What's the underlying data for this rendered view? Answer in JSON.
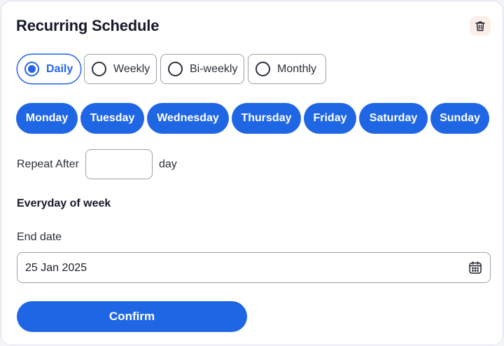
{
  "header": {
    "title": "Recurring Schedule",
    "delete_icon": "trash-icon"
  },
  "frequency": {
    "selected": "Daily",
    "options": [
      "Daily",
      "Weekly",
      "Bi-weekly",
      "Monthly"
    ]
  },
  "days": [
    "Monday",
    "Tuesday",
    "Wednesday",
    "Thursday",
    "Friday",
    "Saturday",
    "Sunday"
  ],
  "repeat": {
    "label": "Repeat After",
    "value": "",
    "unit": "day"
  },
  "summary": "Everyday of week",
  "end_date": {
    "label": "End date",
    "value": "25 Jan 2025",
    "icon": "calendar-icon"
  },
  "confirm_label": "Confirm",
  "colors": {
    "accent": "#1f66e5",
    "selected_text": "#2563eb",
    "trash_bg": "#fbeee9"
  }
}
